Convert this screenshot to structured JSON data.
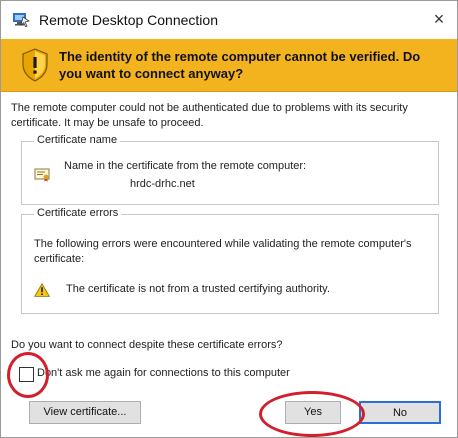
{
  "window": {
    "title": "Remote Desktop Connection",
    "close_glyph": "×"
  },
  "banner": {
    "text": "The identity of the remote computer cannot be verified. Do you want to connect anyway?",
    "icon": "shield-warning-icon",
    "color": "#f3b31f"
  },
  "description": "The remote computer could not be authenticated due to problems with its security certificate. It may be unsafe to proceed.",
  "certificate_name": {
    "title": "Certificate name",
    "label": "Name in the certificate from the remote computer:",
    "value": "hrdc-drhc.net"
  },
  "certificate_errors": {
    "title": "Certificate errors",
    "intro": "The following errors were encountered while validating the remote computer's certificate:",
    "items": [
      "The certificate is not from a trusted certifying authority."
    ]
  },
  "question": "Do you want to connect despite these certificate errors?",
  "dont_ask": {
    "label": "Don't ask me again for connections to this computer",
    "checked": false
  },
  "buttons": {
    "view_certificate": {
      "label": "View certificate..."
    },
    "yes": {
      "label": "Yes"
    },
    "no": {
      "label": "No"
    }
  },
  "annotation_color": "#d21f2b"
}
